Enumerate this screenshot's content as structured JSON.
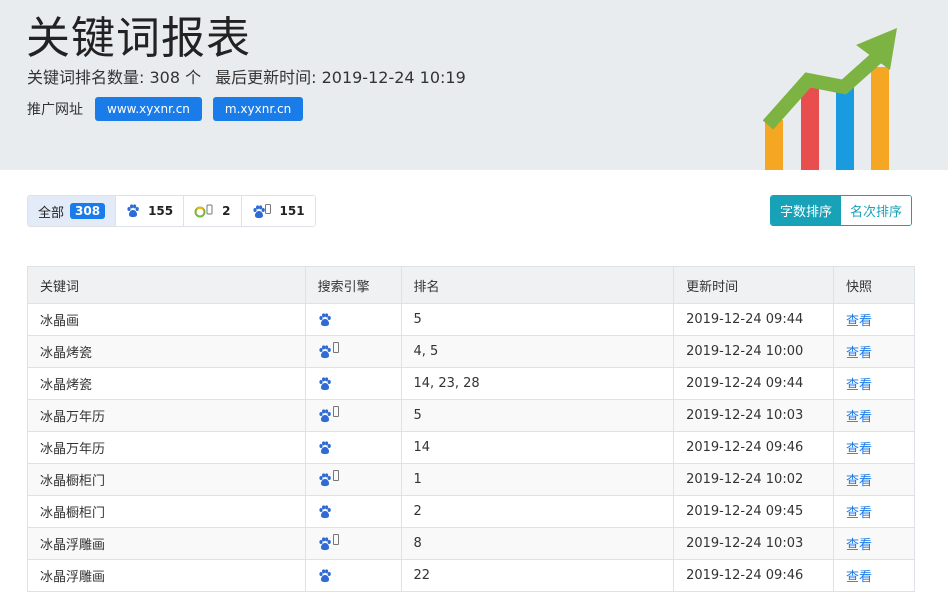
{
  "header": {
    "title": "关键词报表",
    "count_label": "关键词排名数量: 308 个",
    "updated_label": "最后更新时间: 2019-12-24 10:19",
    "promo_label": "推广网址",
    "promo_links": [
      "www.xyxnr.cn",
      "m.xyxnr.cn"
    ],
    "logo_colors": [
      "#f5a623",
      "#e94e4e",
      "#1a9be0",
      "#f5a623",
      "#7cb342"
    ]
  },
  "filters": [
    {
      "label": "全部",
      "count": "308",
      "icon": "",
      "active": true
    },
    {
      "label": "",
      "count": "155",
      "icon": "baidu-paw-icon",
      "active": false
    },
    {
      "label": "",
      "count": "2",
      "icon": "360-mobile-icon",
      "active": false
    },
    {
      "label": "",
      "count": "151",
      "icon": "baidu-mobile-icon",
      "active": false
    }
  ],
  "sort": {
    "by_chars": "字数排序",
    "by_rank": "名次排序"
  },
  "table": {
    "columns": [
      "关键词",
      "搜索引擎",
      "排名",
      "更新时间",
      "快照"
    ],
    "view_label": "查看",
    "rows": [
      {
        "keyword": "冰晶画",
        "engine": "baidu-pc",
        "rank": "5",
        "time": "2019-12-24 09:44"
      },
      {
        "keyword": "冰晶烤瓷",
        "engine": "baidu-mobile",
        "rank": "4, 5",
        "time": "2019-12-24 10:00"
      },
      {
        "keyword": "冰晶烤瓷",
        "engine": "baidu-pc",
        "rank": "14, 23, 28",
        "time": "2019-12-24 09:44"
      },
      {
        "keyword": "冰晶万年历",
        "engine": "baidu-mobile",
        "rank": "5",
        "time": "2019-12-24 10:03"
      },
      {
        "keyword": "冰晶万年历",
        "engine": "baidu-pc",
        "rank": "14",
        "time": "2019-12-24 09:46"
      },
      {
        "keyword": "冰晶橱柜门",
        "engine": "baidu-mobile",
        "rank": "1",
        "time": "2019-12-24 10:02"
      },
      {
        "keyword": "冰晶橱柜门",
        "engine": "baidu-pc",
        "rank": "2",
        "time": "2019-12-24 09:45"
      },
      {
        "keyword": "冰晶浮雕画",
        "engine": "baidu-mobile",
        "rank": "8",
        "time": "2019-12-24 10:03"
      },
      {
        "keyword": "冰晶浮雕画",
        "engine": "baidu-pc",
        "rank": "22",
        "time": "2019-12-24 09:46"
      }
    ]
  }
}
